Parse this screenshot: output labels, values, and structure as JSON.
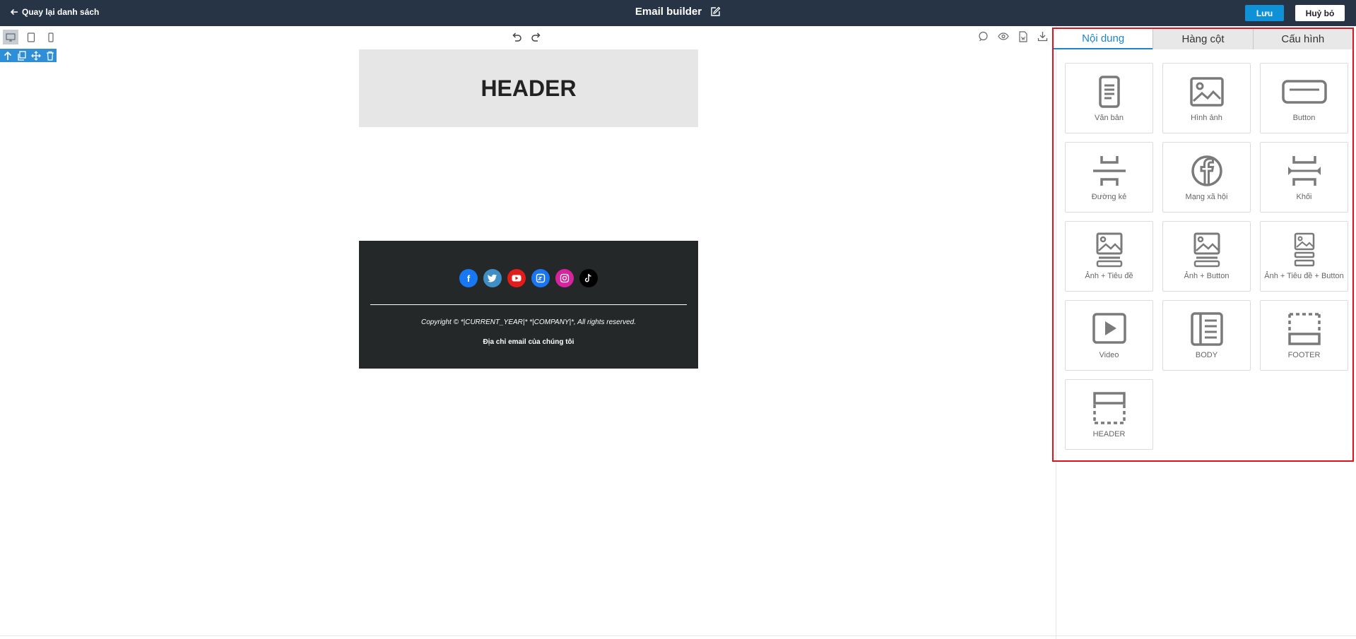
{
  "topbar": {
    "back_label": "Quay lại danh sách",
    "title": "Email builder",
    "save_label": "Lưu",
    "cancel_label": "Huỷ bỏ"
  },
  "canvas": {
    "header_text": "HEADER",
    "footer": {
      "socials": [
        "facebook",
        "twitter",
        "youtube",
        "zalo",
        "instagram",
        "tiktok"
      ],
      "copyright": "Copyright © *|CURRENT_YEAR|* *|COMPANY|*, All rights reserved.",
      "address": "Địa chỉ email của chúng tôi"
    }
  },
  "panel": {
    "tabs": [
      {
        "label": "Nội dung",
        "active": true
      },
      {
        "label": "Hàng cột",
        "active": false
      },
      {
        "label": "Cấu hình",
        "active": false
      }
    ],
    "tiles": [
      {
        "label": "Văn bản",
        "icon": "text-icon"
      },
      {
        "label": "Hình ảnh",
        "icon": "image-icon"
      },
      {
        "label": "Button",
        "icon": "button-icon"
      },
      {
        "label": "Đường kẻ",
        "icon": "divider-icon"
      },
      {
        "label": "Mạng xã hội",
        "icon": "facebook-icon"
      },
      {
        "label": "Khối",
        "icon": "spacer-icon"
      },
      {
        "label": "Ảnh + Tiêu đề",
        "icon": "image-title-icon"
      },
      {
        "label": "Ảnh + Button",
        "icon": "image-button-icon"
      },
      {
        "label": "Ảnh + Tiêu đề + Button",
        "icon": "image-title-button-icon"
      },
      {
        "label": "Video",
        "icon": "video-icon"
      },
      {
        "label": "BODY",
        "icon": "body-icon"
      },
      {
        "label": "FOOTER",
        "icon": "footer-icon"
      },
      {
        "label": "HEADER",
        "icon": "header-icon"
      }
    ]
  },
  "colors": {
    "topbar": "#263446",
    "accent": "#0f91d8",
    "highlight_frame": "#e0121c",
    "footer_bg": "#252828",
    "header_bg": "#e6e6e6"
  }
}
